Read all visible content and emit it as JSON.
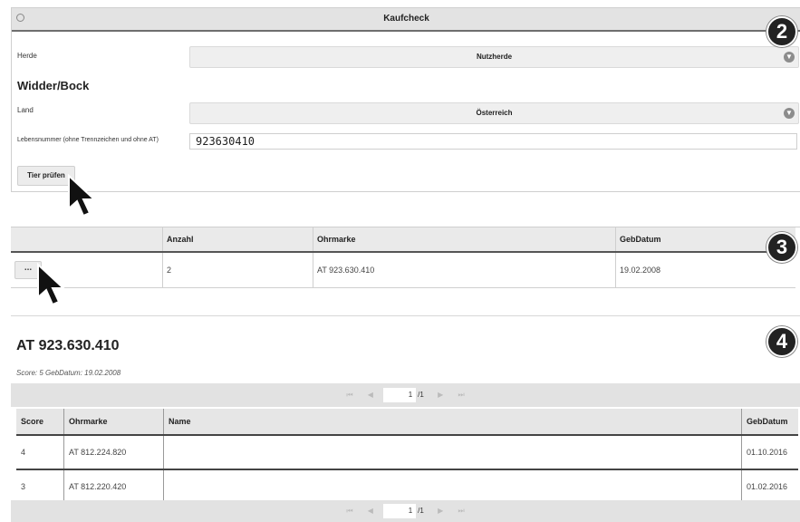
{
  "kaufcheck": {
    "title": "Kaufcheck",
    "herde_label": "Herde",
    "herde_value": "Nutzherde",
    "section_heading": "Widder/Bock",
    "land_label": "Land",
    "land_value": "Österreich",
    "lebensnummer_label": "Lebensnummer (ohne Trennzeichen und ohne AT)",
    "lebensnummer_value": "923630410",
    "check_button": "Tier prüfen"
  },
  "result_table": {
    "headers": [
      "",
      "Anzahl",
      "Ohrmarke",
      "GebDatum"
    ],
    "row": {
      "action": "...",
      "anzahl": "2",
      "ohrmarke": "AT 923.630.410",
      "gebdatum": "19.02.2008"
    }
  },
  "detail": {
    "title": "AT 923.630.410",
    "subinfo": "Score: 5 GebDatum: 19.02.2008",
    "pager_top": {
      "page": "1",
      "total": "/1"
    },
    "headers": [
      "Score",
      "Ohrmarke",
      "Name",
      "GebDatum"
    ],
    "rows": [
      {
        "score": "4",
        "ohrmarke": "AT 812.224.820",
        "name": "",
        "gebdatum": "01.10.2016"
      },
      {
        "score": "3",
        "ohrmarke": "AT 812.220.420",
        "name": "",
        "gebdatum": "01.02.2016"
      }
    ],
    "pager_bottom": {
      "page": "1",
      "total": "/1"
    }
  },
  "badges": [
    "2",
    "3",
    "4"
  ],
  "icons": {
    "chevron": "chevron-down-icon",
    "pager": [
      "first-page-icon",
      "prev-page-icon",
      "next-page-icon",
      "last-page-icon"
    ],
    "cursor": "mouse-pointer-icon"
  },
  "colors": {
    "badge": "#222222",
    "panel_header": "#e3e3e3"
  }
}
